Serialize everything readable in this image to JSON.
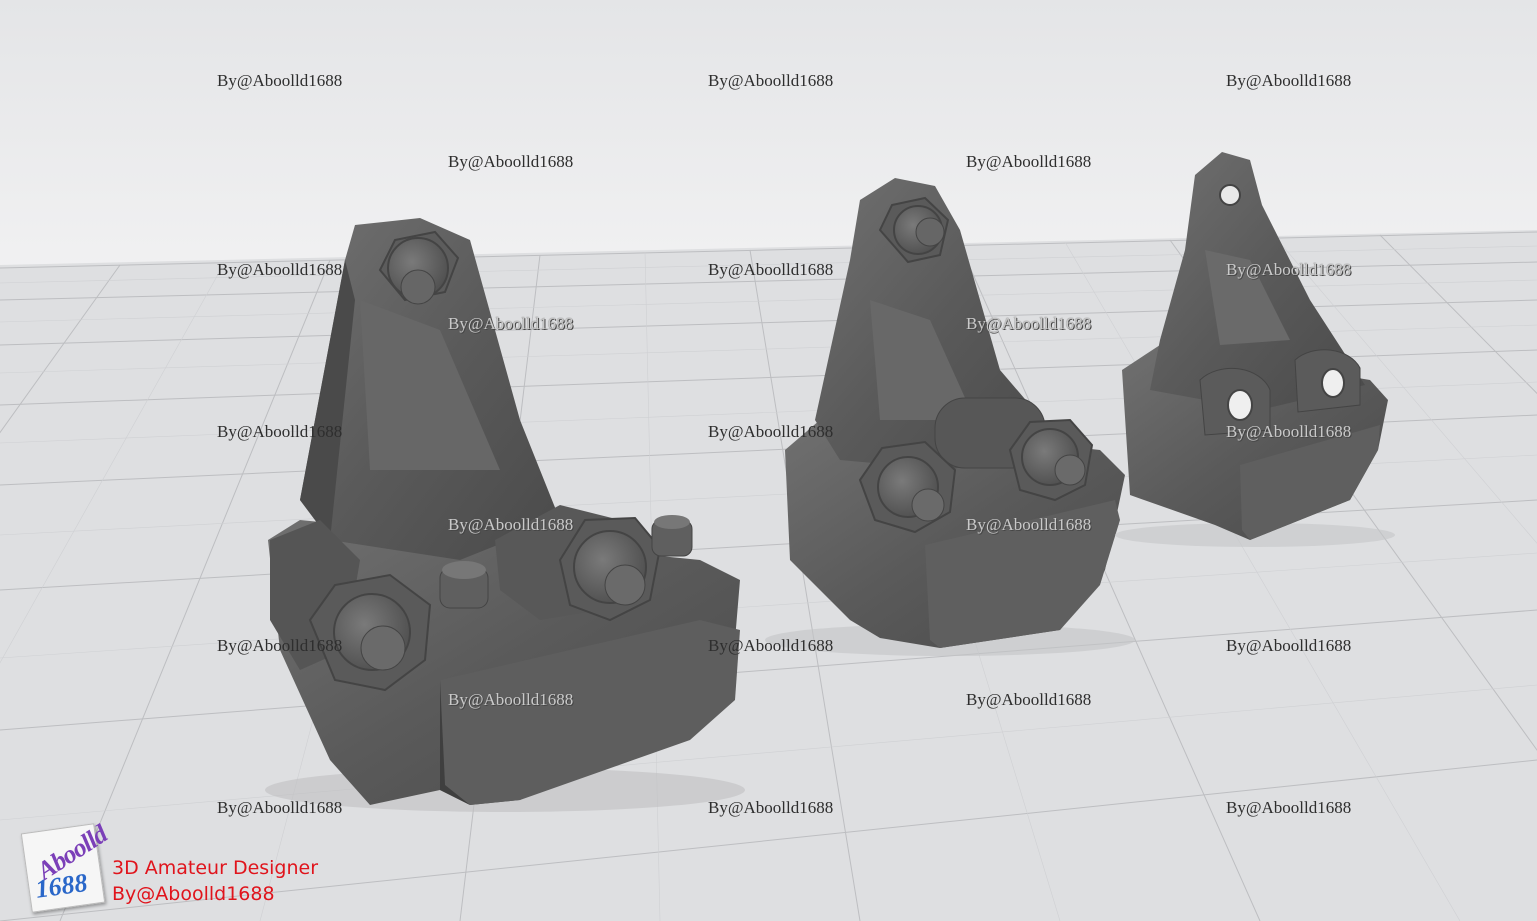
{
  "watermarks": [
    "By@Aboolld1688",
    "By@Aboolld1688",
    "By@Aboolld1688",
    "By@Aboolld1688",
    "By@Aboolld1688",
    "By@Aboolld1688",
    "By@Aboolld1688",
    "By@Aboolld1688",
    "By@Aboolld1688",
    "By@Aboolld1688",
    "By@Aboolld1688",
    "By@Aboolld1688",
    "By@Aboolld1688",
    "By@Aboolld1688",
    "By@Aboolld1688",
    "By@Aboolld1688",
    "By@Aboolld1688",
    "By@Aboolld1688",
    "By@Aboolld1688",
    "By@Aboolld1688",
    "By@Aboolld1688",
    "By@Aboolld1688",
    "By@Aboolld1688"
  ],
  "logo": {
    "word": "Aboolld",
    "number": "1688"
  },
  "credit": {
    "line1": "3D Amateur Designer",
    "line2": "By@Aboolld1688"
  },
  "colors": {
    "model": "#5b5b5b",
    "floor": "#dcdddf",
    "grid": "#b9babd",
    "credit_text": "#e0141c"
  }
}
